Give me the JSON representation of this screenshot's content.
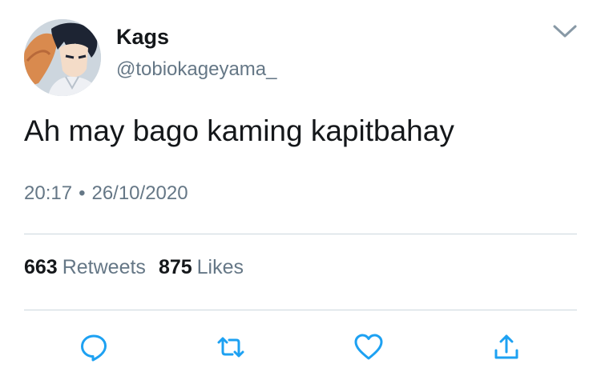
{
  "author": {
    "display_name": "Kags",
    "handle": "@tobiokageyama_",
    "avatar_icon": "avatar-photo"
  },
  "tweet": {
    "text": "Ah may bago kaming kapitbahay",
    "time": "20:17",
    "separator": "•",
    "date": "26/10/2020"
  },
  "stats": {
    "retweets_count": "663",
    "retweets_label": "Retweets",
    "likes_count": "875",
    "likes_label": "Likes"
  },
  "actions": [
    {
      "name": "reply",
      "icon": "reply-icon"
    },
    {
      "name": "retweet",
      "icon": "retweet-icon"
    },
    {
      "name": "like",
      "icon": "heart-icon"
    },
    {
      "name": "share",
      "icon": "share-icon"
    }
  ],
  "colors": {
    "text_primary": "#14171a",
    "text_secondary": "#657786",
    "icon_accent": "#1da1f2",
    "divider": "#ccd6dd",
    "chevron": "#8899a6"
  }
}
